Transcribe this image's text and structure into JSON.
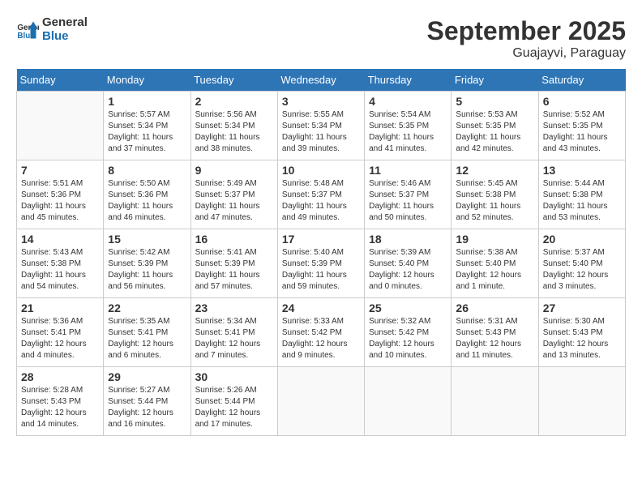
{
  "header": {
    "logo_text_general": "General",
    "logo_text_blue": "Blue",
    "month": "September 2025",
    "location": "Guajayvi, Paraguay"
  },
  "days_of_week": [
    "Sunday",
    "Monday",
    "Tuesday",
    "Wednesday",
    "Thursday",
    "Friday",
    "Saturday"
  ],
  "weeks": [
    [
      {
        "day": "",
        "info": ""
      },
      {
        "day": "1",
        "info": "Sunrise: 5:57 AM\nSunset: 5:34 PM\nDaylight: 11 hours\nand 37 minutes."
      },
      {
        "day": "2",
        "info": "Sunrise: 5:56 AM\nSunset: 5:34 PM\nDaylight: 11 hours\nand 38 minutes."
      },
      {
        "day": "3",
        "info": "Sunrise: 5:55 AM\nSunset: 5:34 PM\nDaylight: 11 hours\nand 39 minutes."
      },
      {
        "day": "4",
        "info": "Sunrise: 5:54 AM\nSunset: 5:35 PM\nDaylight: 11 hours\nand 41 minutes."
      },
      {
        "day": "5",
        "info": "Sunrise: 5:53 AM\nSunset: 5:35 PM\nDaylight: 11 hours\nand 42 minutes."
      },
      {
        "day": "6",
        "info": "Sunrise: 5:52 AM\nSunset: 5:35 PM\nDaylight: 11 hours\nand 43 minutes."
      }
    ],
    [
      {
        "day": "7",
        "info": "Sunrise: 5:51 AM\nSunset: 5:36 PM\nDaylight: 11 hours\nand 45 minutes."
      },
      {
        "day": "8",
        "info": "Sunrise: 5:50 AM\nSunset: 5:36 PM\nDaylight: 11 hours\nand 46 minutes."
      },
      {
        "day": "9",
        "info": "Sunrise: 5:49 AM\nSunset: 5:37 PM\nDaylight: 11 hours\nand 47 minutes."
      },
      {
        "day": "10",
        "info": "Sunrise: 5:48 AM\nSunset: 5:37 PM\nDaylight: 11 hours\nand 49 minutes."
      },
      {
        "day": "11",
        "info": "Sunrise: 5:46 AM\nSunset: 5:37 PM\nDaylight: 11 hours\nand 50 minutes."
      },
      {
        "day": "12",
        "info": "Sunrise: 5:45 AM\nSunset: 5:38 PM\nDaylight: 11 hours\nand 52 minutes."
      },
      {
        "day": "13",
        "info": "Sunrise: 5:44 AM\nSunset: 5:38 PM\nDaylight: 11 hours\nand 53 minutes."
      }
    ],
    [
      {
        "day": "14",
        "info": "Sunrise: 5:43 AM\nSunset: 5:38 PM\nDaylight: 11 hours\nand 54 minutes."
      },
      {
        "day": "15",
        "info": "Sunrise: 5:42 AM\nSunset: 5:39 PM\nDaylight: 11 hours\nand 56 minutes."
      },
      {
        "day": "16",
        "info": "Sunrise: 5:41 AM\nSunset: 5:39 PM\nDaylight: 11 hours\nand 57 minutes."
      },
      {
        "day": "17",
        "info": "Sunrise: 5:40 AM\nSunset: 5:39 PM\nDaylight: 11 hours\nand 59 minutes."
      },
      {
        "day": "18",
        "info": "Sunrise: 5:39 AM\nSunset: 5:40 PM\nDaylight: 12 hours\nand 0 minutes."
      },
      {
        "day": "19",
        "info": "Sunrise: 5:38 AM\nSunset: 5:40 PM\nDaylight: 12 hours\nand 1 minute."
      },
      {
        "day": "20",
        "info": "Sunrise: 5:37 AM\nSunset: 5:40 PM\nDaylight: 12 hours\nand 3 minutes."
      }
    ],
    [
      {
        "day": "21",
        "info": "Sunrise: 5:36 AM\nSunset: 5:41 PM\nDaylight: 12 hours\nand 4 minutes."
      },
      {
        "day": "22",
        "info": "Sunrise: 5:35 AM\nSunset: 5:41 PM\nDaylight: 12 hours\nand 6 minutes."
      },
      {
        "day": "23",
        "info": "Sunrise: 5:34 AM\nSunset: 5:41 PM\nDaylight: 12 hours\nand 7 minutes."
      },
      {
        "day": "24",
        "info": "Sunrise: 5:33 AM\nSunset: 5:42 PM\nDaylight: 12 hours\nand 9 minutes."
      },
      {
        "day": "25",
        "info": "Sunrise: 5:32 AM\nSunset: 5:42 PM\nDaylight: 12 hours\nand 10 minutes."
      },
      {
        "day": "26",
        "info": "Sunrise: 5:31 AM\nSunset: 5:43 PM\nDaylight: 12 hours\nand 11 minutes."
      },
      {
        "day": "27",
        "info": "Sunrise: 5:30 AM\nSunset: 5:43 PM\nDaylight: 12 hours\nand 13 minutes."
      }
    ],
    [
      {
        "day": "28",
        "info": "Sunrise: 5:28 AM\nSunset: 5:43 PM\nDaylight: 12 hours\nand 14 minutes."
      },
      {
        "day": "29",
        "info": "Sunrise: 5:27 AM\nSunset: 5:44 PM\nDaylight: 12 hours\nand 16 minutes."
      },
      {
        "day": "30",
        "info": "Sunrise: 5:26 AM\nSunset: 5:44 PM\nDaylight: 12 hours\nand 17 minutes."
      },
      {
        "day": "",
        "info": ""
      },
      {
        "day": "",
        "info": ""
      },
      {
        "day": "",
        "info": ""
      },
      {
        "day": "",
        "info": ""
      }
    ]
  ]
}
